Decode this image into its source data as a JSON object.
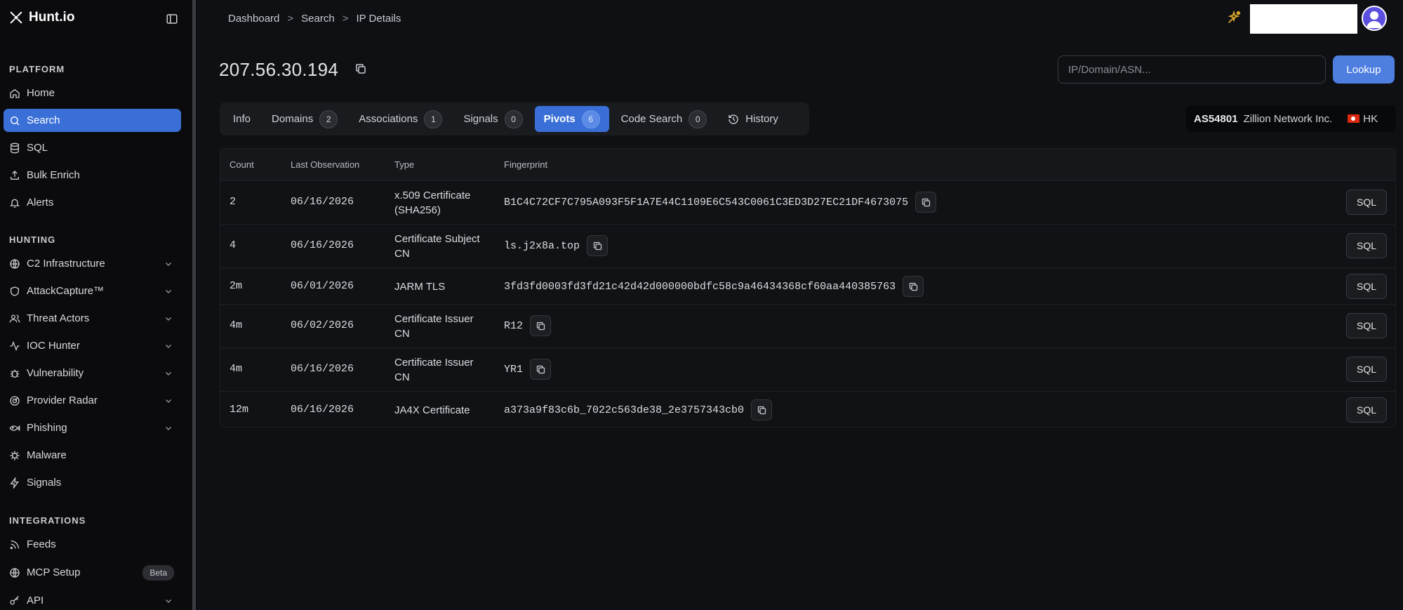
{
  "brand": {
    "name": "Hunt.io"
  },
  "sidebar": {
    "platform_title": "PLATFORM",
    "platform_items": [
      {
        "label": "Home",
        "icon": "home-icon"
      },
      {
        "label": "Search",
        "icon": "search-icon"
      },
      {
        "label": "SQL",
        "icon": "database-icon"
      },
      {
        "label": "Bulk Enrich",
        "icon": "upload-icon"
      },
      {
        "label": "Alerts",
        "icon": "bell-icon"
      }
    ],
    "hunting_title": "HUNTING",
    "hunting_items": [
      {
        "label": "C2 Infrastructure",
        "icon": "globe-icon"
      },
      {
        "label": "AttackCapture™",
        "icon": "shield-icon"
      },
      {
        "label": "Threat Actors",
        "icon": "users-icon"
      },
      {
        "label": "IOC Hunter",
        "icon": "activity-icon"
      },
      {
        "label": "Vulnerability",
        "icon": "bug-icon"
      },
      {
        "label": "Provider Radar",
        "icon": "radar-icon"
      },
      {
        "label": "Phishing",
        "icon": "fish-icon"
      },
      {
        "label": "Malware",
        "icon": "virus-icon"
      },
      {
        "label": "Signals",
        "icon": "zap-icon"
      }
    ],
    "integrations_title": "INTEGRATIONS",
    "integrations_items": [
      {
        "label": "Feeds",
        "icon": "rss-icon"
      },
      {
        "label": "MCP Setup",
        "icon": "globe-icon",
        "badge": "Beta"
      },
      {
        "label": "API",
        "icon": "key-icon"
      }
    ]
  },
  "breadcrumb": [
    "Dashboard",
    "Search",
    "IP Details"
  ],
  "page": {
    "ip": "207.56.30.194"
  },
  "search": {
    "placeholder": "IP/Domain/ASN...",
    "button": "Lookup"
  },
  "tabs": [
    {
      "label": "Info"
    },
    {
      "label": "Domains",
      "count": "2"
    },
    {
      "label": "Associations",
      "count": "1"
    },
    {
      "label": "Signals",
      "count": "0"
    },
    {
      "label": "Pivots",
      "count": "6",
      "active": true
    },
    {
      "label": "Code Search",
      "count": "0"
    },
    {
      "label": "History"
    }
  ],
  "asn": {
    "number": "AS54801",
    "name": "Zillion Network Inc.",
    "country": "HK"
  },
  "table": {
    "headers": [
      "Count",
      "Last Observation",
      "Type",
      "Fingerprint"
    ],
    "rows": [
      {
        "count": "2",
        "date": "06/16/2026",
        "type": "x.509 Certificate (SHA256)",
        "fingerprint": "B1C4C72CF7C795A093F5F1A7E44C1109E6C543C0061C3ED3D27EC21DF4673075"
      },
      {
        "count": "4",
        "date": "06/16/2026",
        "type": "Certificate Subject CN",
        "fingerprint": "ls.j2x8a.top"
      },
      {
        "count": "2m",
        "date": "06/01/2026",
        "type": "JARM TLS",
        "fingerprint": "3fd3fd0003fd3fd21c42d42d000000bdfc58c9a46434368cf60aa440385763"
      },
      {
        "count": "4m",
        "date": "06/02/2026",
        "type": "Certificate Issuer CN",
        "fingerprint": "R12"
      },
      {
        "count": "4m",
        "date": "06/16/2026",
        "type": "Certificate Issuer CN",
        "fingerprint": "YR1"
      },
      {
        "count": "12m",
        "date": "06/16/2026",
        "type": "JA4X Certificate",
        "fingerprint": "a373a9f83c6b_7022c563de38_2e3757343cb0"
      }
    ],
    "sql_label": "SQL"
  },
  "colors": {
    "accent": "#3a6fd8",
    "lookup": "#4d7ee0",
    "background": "#0f1013"
  }
}
